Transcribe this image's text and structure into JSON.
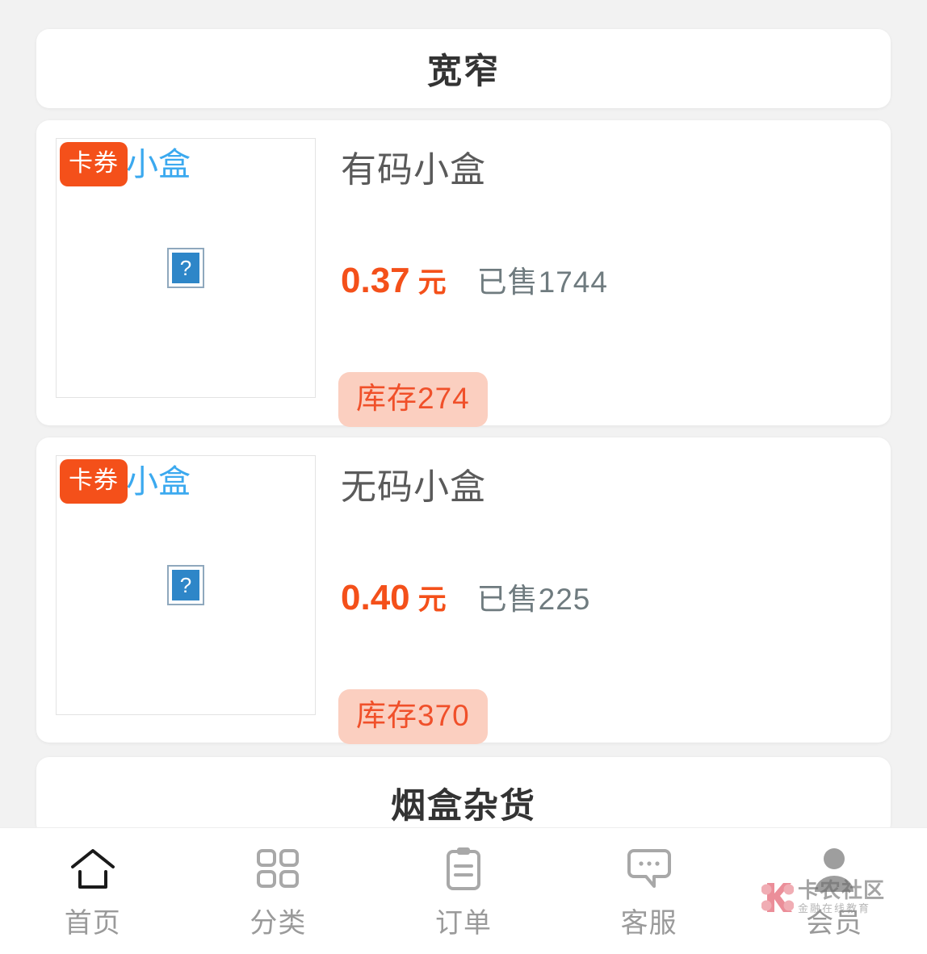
{
  "sections": [
    {
      "title": "宽窄"
    },
    {
      "title": "烟盒杂货"
    }
  ],
  "products": [
    {
      "badge": "卡券",
      "alt_text": "有码小盒",
      "title": "有码小盒",
      "price": "0.37",
      "price_unit": "元",
      "sold": "已售1744",
      "stock": "库存274"
    },
    {
      "badge": "卡券",
      "alt_text": "无码小盒",
      "title": "无码小盒",
      "price": "0.40",
      "price_unit": "元",
      "sold": "已售225",
      "stock": "库存370"
    }
  ],
  "bottom_nav": {
    "items": [
      {
        "label": "首页",
        "icon": "home-icon"
      },
      {
        "label": "分类",
        "icon": "grid-icon"
      },
      {
        "label": "订单",
        "icon": "clipboard-icon"
      },
      {
        "label": "客服",
        "icon": "chat-icon"
      },
      {
        "label": "会员",
        "icon": "person-icon"
      }
    ]
  },
  "watermark": {
    "main": "卡农社区",
    "sub": "金融在线教育"
  },
  "colors": {
    "accent": "#f4501a",
    "page_bg": "#f2f2f2",
    "card_bg": "#ffffff",
    "alt_text": "#3ba9ef",
    "stock_bg": "#fbcfc0",
    "stock_fg": "#f0502a",
    "sold_fg": "#6f7b7f",
    "title_fg": "#5a5a5a",
    "nav_label": "#9a9a9a"
  }
}
